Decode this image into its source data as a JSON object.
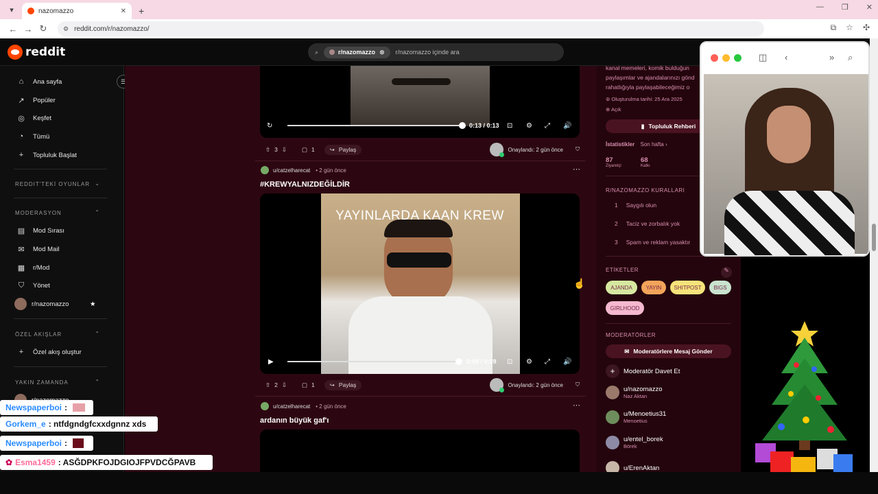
{
  "browser": {
    "tab_title": "nazomazzo",
    "new_tab": "+",
    "url": "reddit.com/r/nazomazzo/"
  },
  "header": {
    "logo_text": "reddit",
    "search_chip": "r/nazomazzo",
    "search_placeholder": "r/nazomazzo içinde ara"
  },
  "sidebar": {
    "items": [
      "Ana sayfa",
      "Popüler",
      "Keşfet",
      "Tümü",
      "Topluluk Başlat"
    ],
    "games_header": "REDDIT'TEKİ OYUNLAR",
    "mod_header": "MODERASYON",
    "mod_items": [
      "Mod Sırası",
      "Mod Mail",
      "r/Mod",
      "Yönet",
      "r/nazomazzo"
    ],
    "custom_header": "ÖZEL AKIŞLAR",
    "custom_item": "Özel akış oluştur",
    "recent_header": "YAKIN ZAMANDA",
    "recent_item": "r/nazomazzo"
  },
  "posts": [
    {
      "time": "0:13 / 0:13",
      "progress": 1.0,
      "votes": "3",
      "comments": "1",
      "share": "Paylaş",
      "approved": "Onaylandı: 2 gün önce"
    },
    {
      "author": "u/catzelharecat",
      "ago": "• 2 gün önce",
      "title": "#KREWYALNIZDEĞİLDİR",
      "caption": "YAYINLARDA KAAN KREW",
      "time": "0:09 / 0:09",
      "progress": 0.98,
      "votes": "2",
      "comments": "1",
      "share": "Paylaş",
      "approved": "Onaylandı: 2 gün önce"
    },
    {
      "author": "u/catzelharecat",
      "ago": "• 2 gün önce",
      "title": "ardanın büyük gaf'ı"
    }
  ],
  "right_panel": {
    "desc_lines": [
      "kanal memeleri, komik bulduğun",
      "paylaşımlar ve ajandalarınızı gönd",
      "rahatlığıyla paylaşabileceğimiz o"
    ],
    "created": "Oluşturulma tarihi: 25 Ara 2025",
    "visibility": "Açık",
    "guide_button": "Topluluk Rehberi",
    "stats_header": "İstatistikler",
    "stats_period": "Son hafta",
    "stats": [
      {
        "value": "87",
        "label": "Ziyaretçi"
      },
      {
        "value": "68",
        "label": "Katkı"
      }
    ],
    "rules_header": "R/NAZOMAZZO KURALLARI",
    "rules": [
      {
        "num": "1",
        "text": "Saygılı olun"
      },
      {
        "num": "2",
        "text": "Taciz ve zorbalık yok"
      },
      {
        "num": "3",
        "text": "Spam ve reklam yasaktır"
      }
    ],
    "tags_header": "ETİKETLER",
    "tags": [
      {
        "label": "AJANDA",
        "color": "#d6e8a0"
      },
      {
        "label": "YAYIN",
        "color": "#f2a45a"
      },
      {
        "label": "SHITPOST",
        "color": "#f6e37a"
      },
      {
        "label": "BIGS",
        "color": "#c9e3cf"
      },
      {
        "label": "GIRLHOOD",
        "color": "#f4b8cf"
      }
    ],
    "mods_header": "MODERATÖRLER",
    "message_mods": "Moderatörlere Mesaj Gönder",
    "invite_mod": "Moderatör Davet Et",
    "moderators": [
      {
        "name": "u/nazomazzo",
        "sub": "Naz Aktan"
      },
      {
        "name": "u/Menoetius31",
        "sub": "Menoetius"
      },
      {
        "name": "u/entel_borek",
        "sub": "Börek"
      },
      {
        "name": "u/ErenAktan",
        "sub": ""
      }
    ]
  },
  "chat": [
    {
      "user": "Newspaperboi",
      "msg": ":"
    },
    {
      "user": "Gorkem_e",
      "msg": ": ntfdgndgfcxxdgnnz xds"
    },
    {
      "user": "Newspaperboi",
      "msg": ":"
    },
    {
      "user": "Esma1459",
      "msg": ": ASĞDPKFOJDGIOJFPVDCĞPAVB"
    }
  ]
}
